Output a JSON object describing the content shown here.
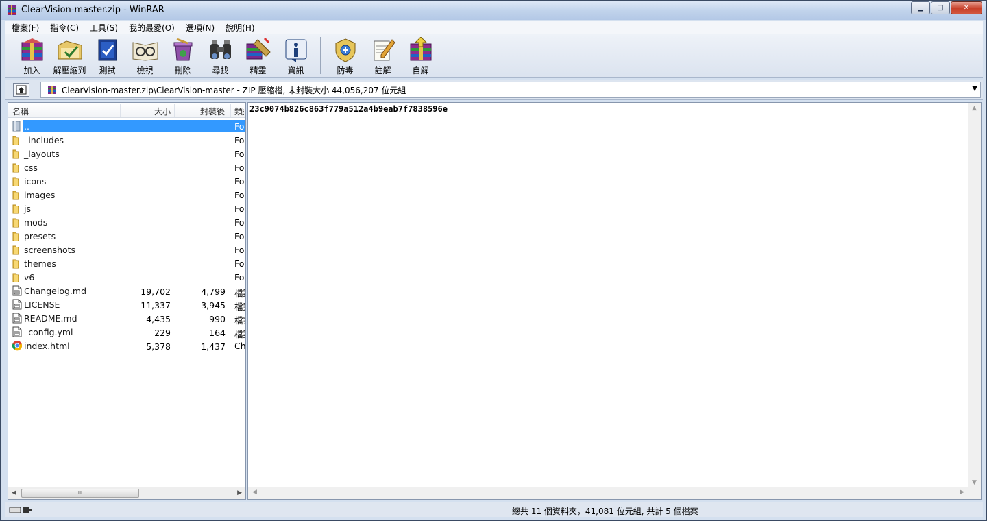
{
  "window": {
    "title": "ClearVision-master.zip - WinRAR",
    "controls": {
      "minimize": "▁",
      "maximize": "□",
      "close": "✕"
    }
  },
  "menu": [
    "檔案(F)",
    "指令(C)",
    "工具(S)",
    "我的最愛(O)",
    "選項(N)",
    "說明(H)"
  ],
  "toolbar": [
    {
      "label": "加入",
      "icon": "add-archive-icon"
    },
    {
      "label": "解壓縮到",
      "icon": "extract-to-icon"
    },
    {
      "label": "測試",
      "icon": "test-icon"
    },
    {
      "label": "檢視",
      "icon": "view-icon"
    },
    {
      "label": "刪除",
      "icon": "delete-icon"
    },
    {
      "label": "尋找",
      "icon": "find-icon"
    },
    {
      "label": "精靈",
      "icon": "wizard-icon"
    },
    {
      "label": "資訊",
      "icon": "info-icon"
    },
    {
      "label": "防毒",
      "icon": "virus-scan-icon"
    },
    {
      "label": "註解",
      "icon": "comment-icon"
    },
    {
      "label": "自解",
      "icon": "sfx-icon"
    }
  ],
  "address": {
    "path": "ClearVision-master.zip\\ClearVision-master - ZIP 壓縮檔, 未封裝大小 44,056,207 位元組",
    "dropdown": "▼"
  },
  "columns": {
    "name": "名稱",
    "size": "大小",
    "packed": "封裝後",
    "type": "類型"
  },
  "files": [
    {
      "name": "..",
      "size": "",
      "packed": "",
      "type": "Fo",
      "kind": "parent",
      "selected": true
    },
    {
      "name": "_includes",
      "size": "",
      "packed": "",
      "type": "Fo",
      "kind": "folder"
    },
    {
      "name": "_layouts",
      "size": "",
      "packed": "",
      "type": "Fo",
      "kind": "folder"
    },
    {
      "name": "css",
      "size": "",
      "packed": "",
      "type": "Fo",
      "kind": "folder"
    },
    {
      "name": "icons",
      "size": "",
      "packed": "",
      "type": "Fo",
      "kind": "folder"
    },
    {
      "name": "images",
      "size": "",
      "packed": "",
      "type": "Fo",
      "kind": "folder"
    },
    {
      "name": "js",
      "size": "",
      "packed": "",
      "type": "Fo",
      "kind": "folder"
    },
    {
      "name": "mods",
      "size": "",
      "packed": "",
      "type": "Fo",
      "kind": "folder"
    },
    {
      "name": "presets",
      "size": "",
      "packed": "",
      "type": "Fo",
      "kind": "folder"
    },
    {
      "name": "screenshots",
      "size": "",
      "packed": "",
      "type": "Fo",
      "kind": "folder"
    },
    {
      "name": "themes",
      "size": "",
      "packed": "",
      "type": "Fo",
      "kind": "folder"
    },
    {
      "name": "v6",
      "size": "",
      "packed": "",
      "type": "Fo",
      "kind": "folder"
    },
    {
      "name": "Changelog.md",
      "size": "19,702",
      "packed": "4,799",
      "type": "檔案",
      "kind": "file"
    },
    {
      "name": "LICENSE",
      "size": "11,337",
      "packed": "3,945",
      "type": "檔案",
      "kind": "file"
    },
    {
      "name": "README.md",
      "size": "4,435",
      "packed": "990",
      "type": "檔案",
      "kind": "file"
    },
    {
      "name": "_config.yml",
      "size": "229",
      "packed": "164",
      "type": "檔案",
      "kind": "file"
    },
    {
      "name": "index.html",
      "size": "5,378",
      "packed": "1,437",
      "type": "Ch",
      "kind": "chrome"
    }
  ],
  "viewer": {
    "content": "23c9074b826c863f779a512a4b9eab7f7838596e"
  },
  "scroll": {
    "left": "◀",
    "right": "▶",
    "up": "▲",
    "down": "▼",
    "grip": "III"
  },
  "status": {
    "text": "總共 11 個資料夾，41,081 位元組, 共計 5 個檔案"
  }
}
